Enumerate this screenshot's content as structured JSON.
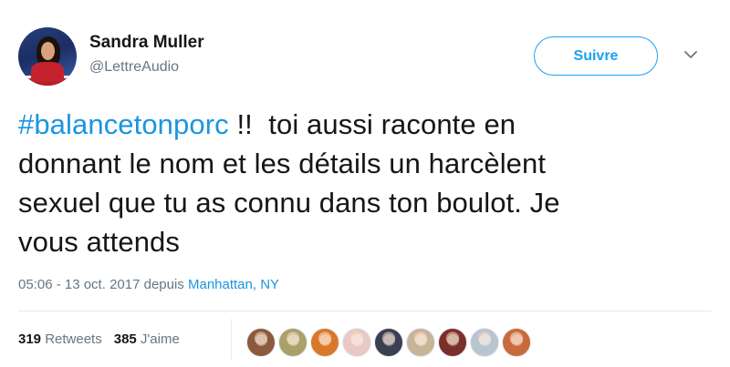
{
  "tweet": {
    "author": {
      "name": "Sandra Muller",
      "handle": "@LettreAudio"
    },
    "follow_label": "Suivre",
    "text_lines": [
      {
        "hashtag": "#balancetonporc",
        "rest": " !!  toi aussi raconte en"
      },
      {
        "text": "donnant le nom et les détails un harcèlent"
      },
      {
        "text": "sexuel que tu as connu dans ton boulot. Je"
      },
      {
        "text": "vous attends"
      }
    ],
    "timestamp": "05:06 - 13 oct. 2017 depuis ",
    "location": "Manhattan, NY",
    "stats": {
      "retweets_count": "319",
      "retweets_label": " Retweets",
      "likes_count": "385",
      "likes_label": " J'aime"
    }
  },
  "colors": {
    "accent": "#1da1f2",
    "link": "#1b95e0",
    "secondary_text": "#657786",
    "primary_text": "#14171a",
    "divider": "#e6ecf0"
  },
  "likers": [
    {
      "color": "#8b5a3c"
    },
    {
      "color": "#a9a06a"
    },
    {
      "color": "#d9782a"
    },
    {
      "color": "#e9c9c6"
    },
    {
      "color": "#3a3f52"
    },
    {
      "color": "#c7b59a"
    },
    {
      "color": "#7a2f2b"
    },
    {
      "color": "#b8c4cf"
    },
    {
      "color": "#c76a3e"
    }
  ],
  "icons": {
    "menu": "chevron-down-icon"
  }
}
